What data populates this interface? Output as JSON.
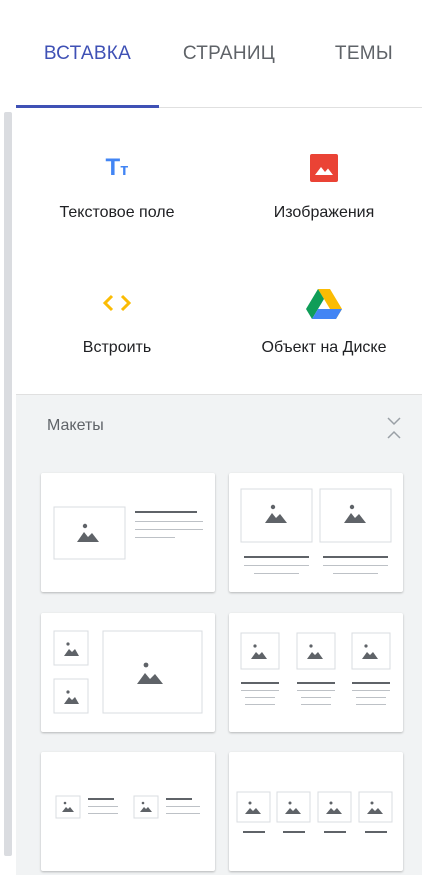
{
  "tabs": [
    {
      "label": "ВСТАВКА",
      "active": true
    },
    {
      "label": "СТРАНИЦ",
      "active": false
    },
    {
      "label": "ТЕМЫ",
      "active": false
    }
  ],
  "insert": {
    "text_box": {
      "label": "Текстовое поле",
      "icon": "text-box-icon"
    },
    "images": {
      "label": "Изображения",
      "icon": "image-icon"
    },
    "embed": {
      "label": "Встроить",
      "icon": "embed-icon"
    },
    "drive": {
      "label": "Объект на Диске",
      "icon": "google-drive-icon"
    }
  },
  "layouts": {
    "title": "Макеты",
    "items": [
      "layout-image-left-text",
      "layout-two-images",
      "layout-image-grid-large",
      "layout-three-images",
      "layout-two-image-text",
      "layout-four-images"
    ]
  },
  "colors": {
    "accent": "#3f51b5",
    "text_icon": "#4285f4",
    "image_icon": "#ea4335",
    "embed_icon": "#fbbc04"
  }
}
